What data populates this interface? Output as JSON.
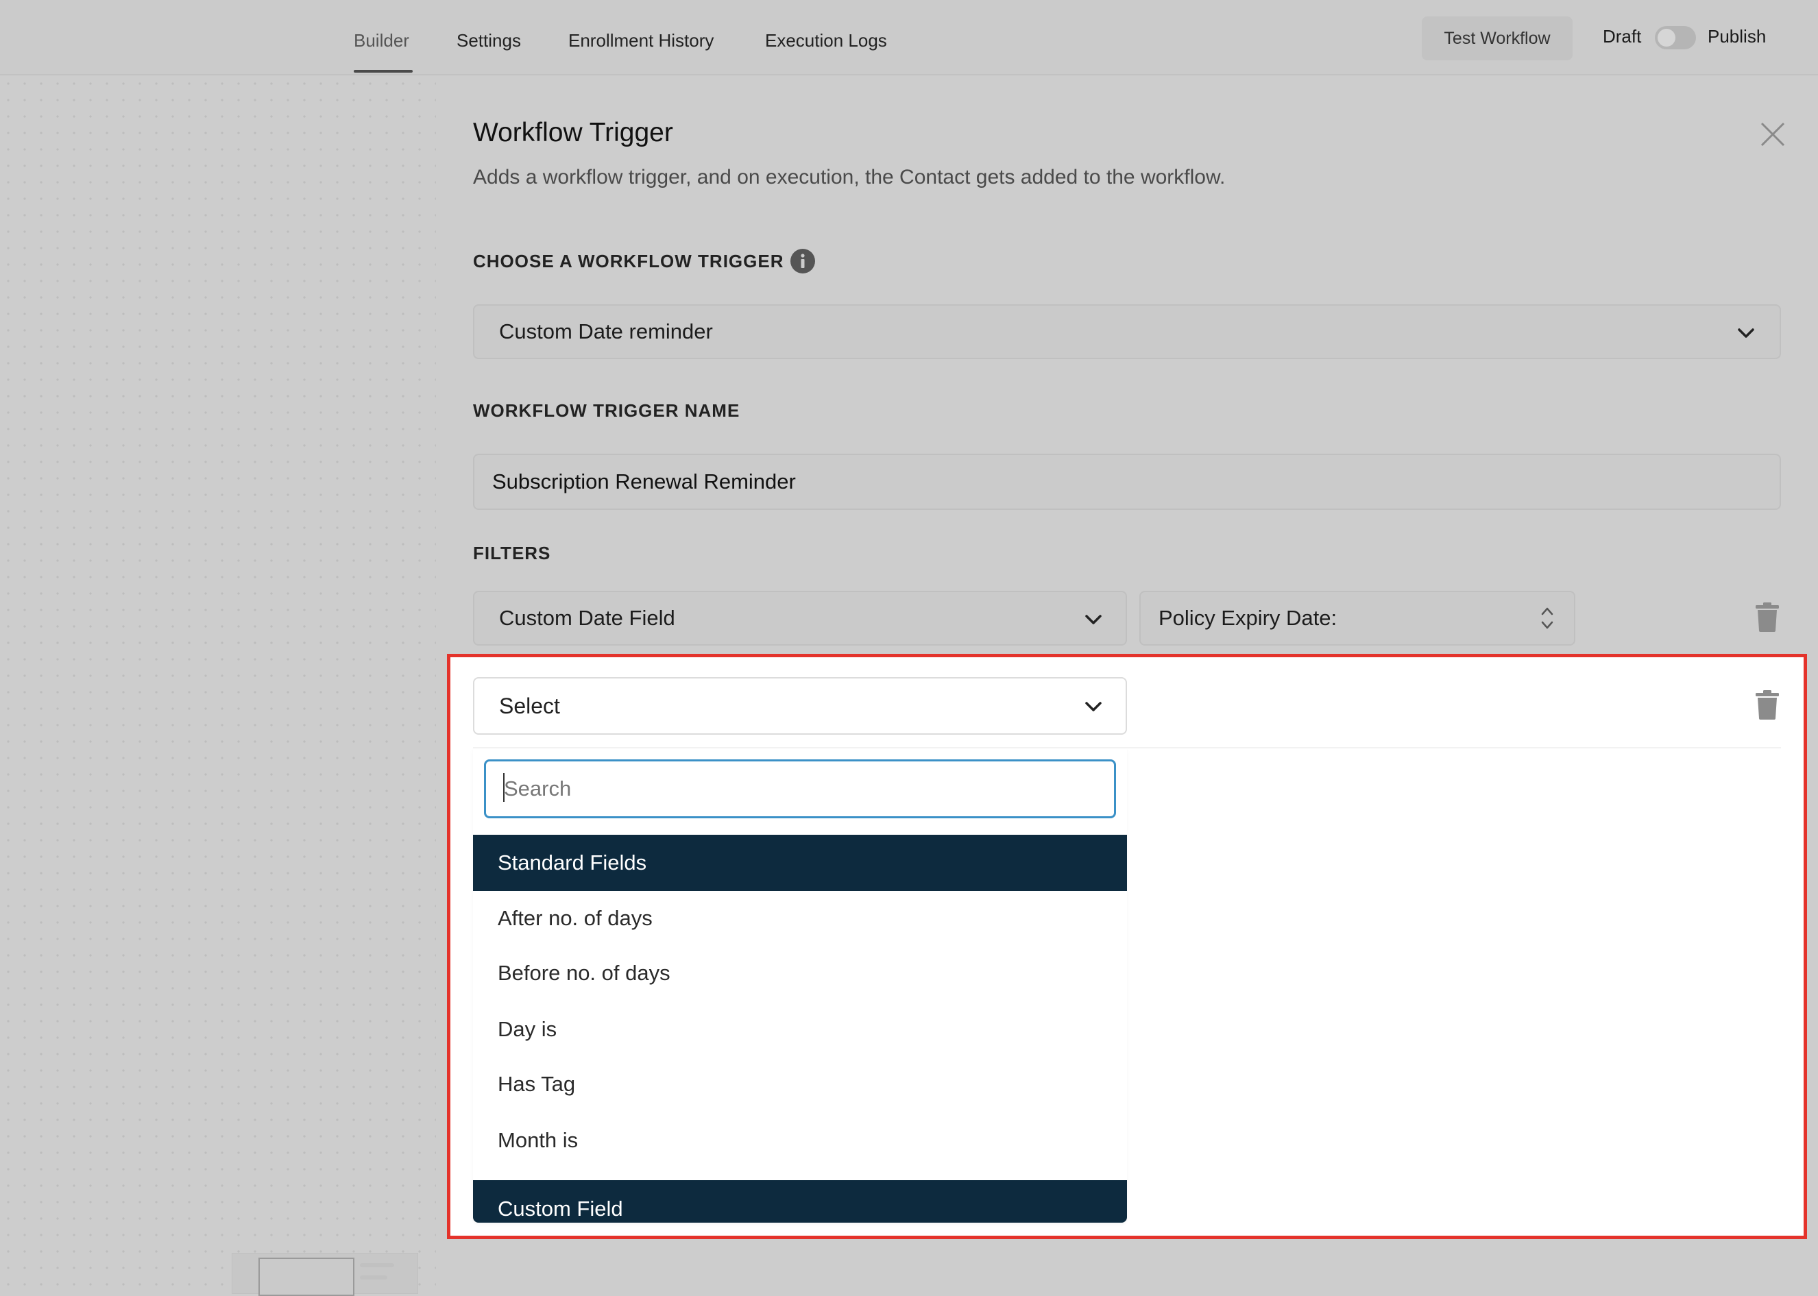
{
  "header": {
    "tabs": [
      {
        "label": "Builder",
        "active": true
      },
      {
        "label": "Settings",
        "active": false
      },
      {
        "label": "Enrollment History",
        "active": false
      },
      {
        "label": "Execution Logs",
        "active": false
      }
    ],
    "test_button": "Test Workflow",
    "draft_label": "Draft",
    "publish_label": "Publish",
    "publish_toggle_on": false
  },
  "panel": {
    "title": "Workflow Trigger",
    "description": "Adds a workflow trigger, and on execution, the Contact gets added to the workflow.",
    "trigger_section_label": "CHOOSE A WORKFLOW TRIGGER",
    "trigger_value": "Custom Date reminder",
    "name_section_label": "WORKFLOW TRIGGER NAME",
    "name_value": "Subscription Renewal Reminder",
    "filters_label": "FILTERS",
    "filter1": {
      "field": "Custom Date Field",
      "value": "Policy Expiry Date:"
    },
    "filter2": {
      "field": "Select"
    }
  },
  "dropdown": {
    "search_placeholder": "Search",
    "groups": [
      {
        "header": "Standard Fields",
        "options": [
          "After no. of days",
          "Before no. of days",
          "Day is",
          "Has Tag",
          "Month is"
        ]
      },
      {
        "header": "Custom Field",
        "options": []
      }
    ]
  },
  "colors": {
    "group_header_bg": "#0d2a3e",
    "highlight_border": "#e4332b",
    "search_focus_border": "#3b91c7"
  },
  "icons": {
    "info": "info-icon",
    "close": "close-icon",
    "chevron": "chevron-down-icon",
    "stepper": "up-down-icon",
    "delete": "trash-icon"
  }
}
